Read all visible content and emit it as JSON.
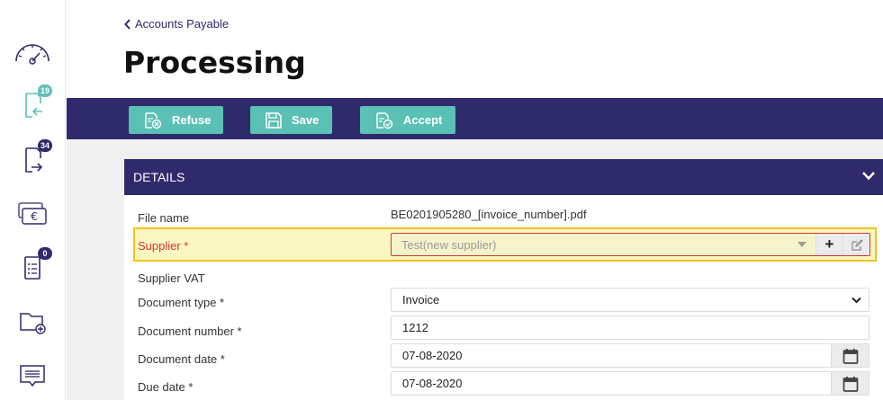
{
  "breadcrumb": {
    "back_label": "Accounts Payable"
  },
  "page": {
    "title": "Processing"
  },
  "sidebar": {
    "items": [
      {
        "icon": "dashboard-gauge-icon",
        "badge": ""
      },
      {
        "icon": "incoming-documents-icon",
        "badge": "19"
      },
      {
        "icon": "outgoing-documents-icon",
        "badge": "34"
      },
      {
        "icon": "payments-euro-icon",
        "badge": ""
      },
      {
        "icon": "document-list-icon",
        "badge": "0"
      },
      {
        "icon": "add-folder-icon",
        "badge": ""
      },
      {
        "icon": "messages-icon",
        "badge": ""
      }
    ]
  },
  "toolbar": {
    "refuse_label": "Refuse",
    "save_label": "Save",
    "accept_label": "Accept"
  },
  "details": {
    "header": "DETAILS",
    "file_name_label": "File name",
    "file_name_value": "BE0201905280_[invoice_number].pdf",
    "supplier_label": "Supplier *",
    "supplier_value": "Test(new supplier)",
    "supplier_vat_label": "Supplier VAT",
    "document_type_label": "Document type *",
    "document_type_value": "Invoice",
    "document_number_label": "Document number *",
    "document_number_value": "1212",
    "document_date_label": "Document date *",
    "document_date_value": "07-08-2020",
    "due_date_label": "Due date *",
    "due_date_value": "07-08-2020"
  },
  "colors": {
    "primary": "#2e2a6b",
    "accent": "#5bc0b5",
    "highlight_bg": "#fbf7c3",
    "highlight_border": "#f3c21d",
    "error": "#d9322b"
  }
}
